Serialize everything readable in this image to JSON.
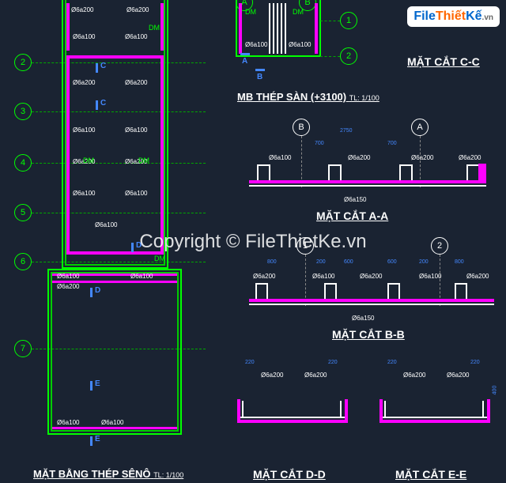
{
  "logo": {
    "part1": "File",
    "part2": "Thiết",
    "part3": "Kế",
    "tld": ".vn"
  },
  "watermark": "Copyright © FileThietKe.vn",
  "grid_rows": [
    "2",
    "3",
    "4",
    "5",
    "6",
    "7"
  ],
  "grid_cols_top": [
    "A",
    "B"
  ],
  "grid_cols_right": [
    "1",
    "2"
  ],
  "grid_section_AA": [
    "B",
    "A"
  ],
  "grid_section_BB": [
    "1",
    "2"
  ],
  "rebar": {
    "d6_200": "Ø6a200",
    "d6_100": "Ø6a100",
    "d6_150": "Ø6a150"
  },
  "dm": "DM",
  "section_marks": {
    "a": "A",
    "b": "B",
    "c": "C",
    "d": "D",
    "e": "E"
  },
  "titles": {
    "mb_thep_san": "MB THÉP SÀN (+3100)",
    "mb_thep_san_scale": "TL: 1/100",
    "cc": "MẶT CẮT C-C",
    "aa": "MẶT CẮT A-A",
    "bb": "MẶT CẮT B-B",
    "dd": "MẶT CẮT D-D",
    "ee": "MẶT CẮT E-E",
    "seno": "MẶT BẰNG THÉP SÊNÔ",
    "seno_scale": "TL: 1/100"
  },
  "dims": {
    "d2750": "2750",
    "d700": "700",
    "d800": "800",
    "d200": "200",
    "d600": "600",
    "d220": "220",
    "d400": "400"
  }
}
